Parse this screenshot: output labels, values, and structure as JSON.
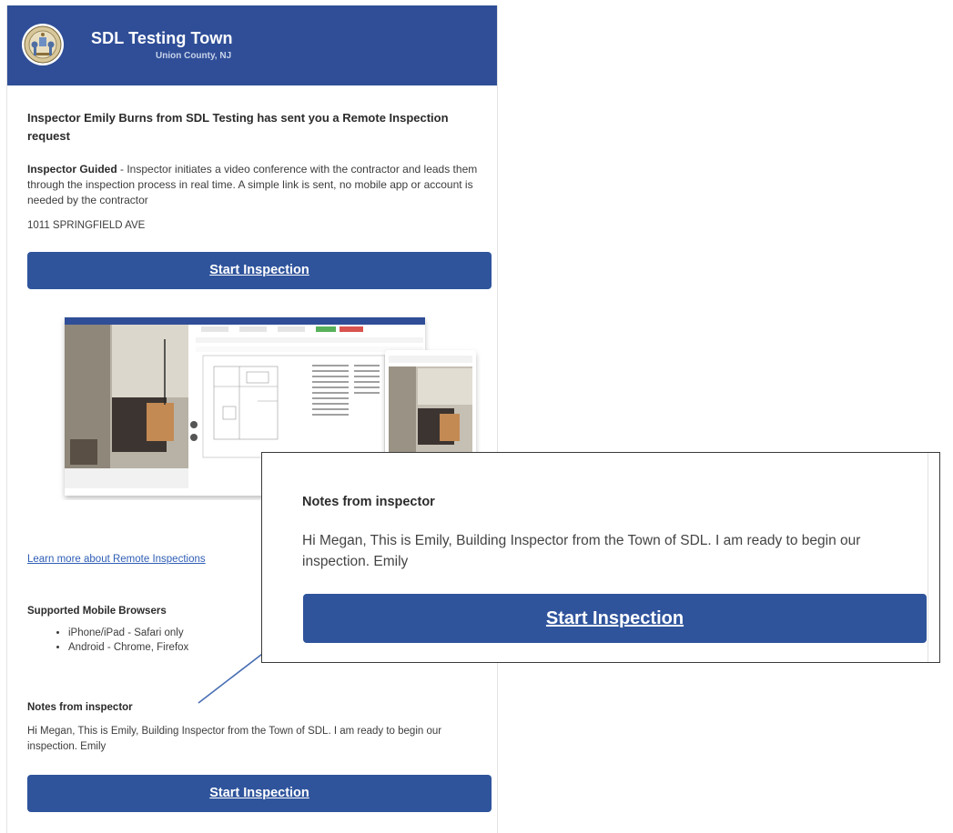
{
  "header": {
    "town": "SDL Testing Town",
    "county": "Union County, NJ",
    "color": "#2f4e97"
  },
  "content": {
    "headline": "Inspector Emily Burns from SDL Testing has sent you a Remote Inspection request",
    "guided_label": "Inspector Guided",
    "guided_text": " - Inspector initiates a video conference with the contractor and leads them through the inspection process in real time. A simple link is sent, no mobile app or account is needed by the contractor",
    "address": "1011 SPRINGFIELD AVE",
    "start_button": "Start Inspection",
    "learn_more": "Learn more about Remote Inspections",
    "browsers_heading": "Supported Mobile Browsers",
    "browsers": [
      "iPhone/iPad - Safari only",
      "Android - Chrome, Firefox"
    ],
    "notes_heading": "Notes from inspector",
    "notes": "Hi Megan, This is Emily, Building Inspector from the Town of SDL. I am ready to begin our inspection. Emily",
    "button_color": "#2f549c"
  },
  "callout": {
    "notes_heading": "Notes from inspector",
    "notes": "Hi Megan, This is Emily, Building Inspector from the Town of SDL. I am ready to begin our inspection. Emily",
    "start_button": "Start Inspection"
  }
}
